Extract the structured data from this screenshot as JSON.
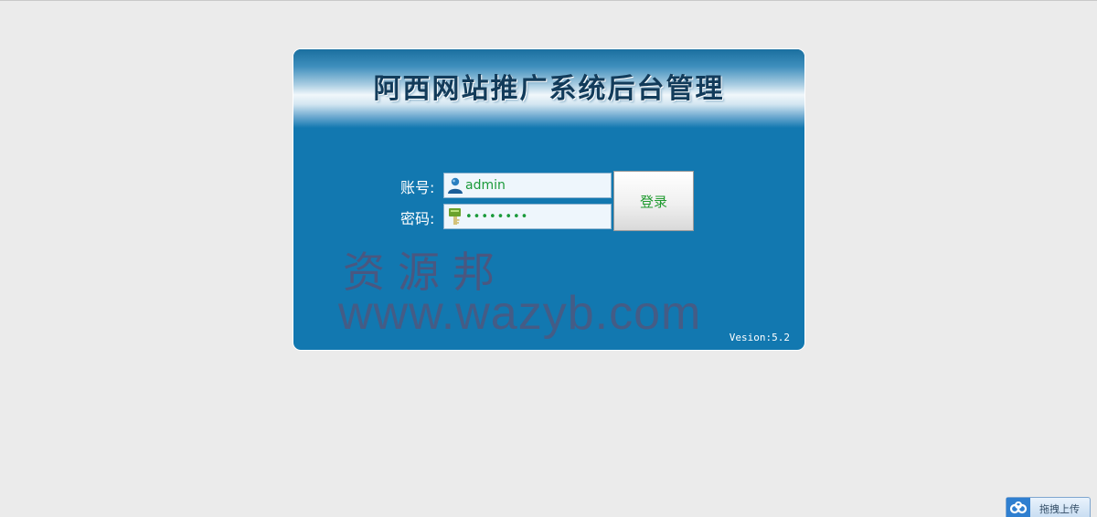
{
  "header": {
    "title": "阿西网站推广系统后台管理"
  },
  "login_form": {
    "account_label": "账号:",
    "password_label": "密码:",
    "account_value": "admin",
    "password_value": "••••••••",
    "login_button_label": "登录"
  },
  "footer": {
    "version": "Vesion:5.2"
  },
  "watermark": {
    "chinese": "资源邦",
    "url": "www.wazyb.com"
  },
  "upload_widget": {
    "label": "拖拽上传"
  },
  "colors": {
    "page_background": "#ebebeb",
    "panel_background": "#1278b0",
    "input_text": "#1a9a3a",
    "button_text": "#1f9a2f",
    "title_text": "#123b5a"
  },
  "icons": {
    "account_icon": "user-icon",
    "password_icon": "key-icon",
    "upload_icon": "upload-cloud-icon"
  }
}
